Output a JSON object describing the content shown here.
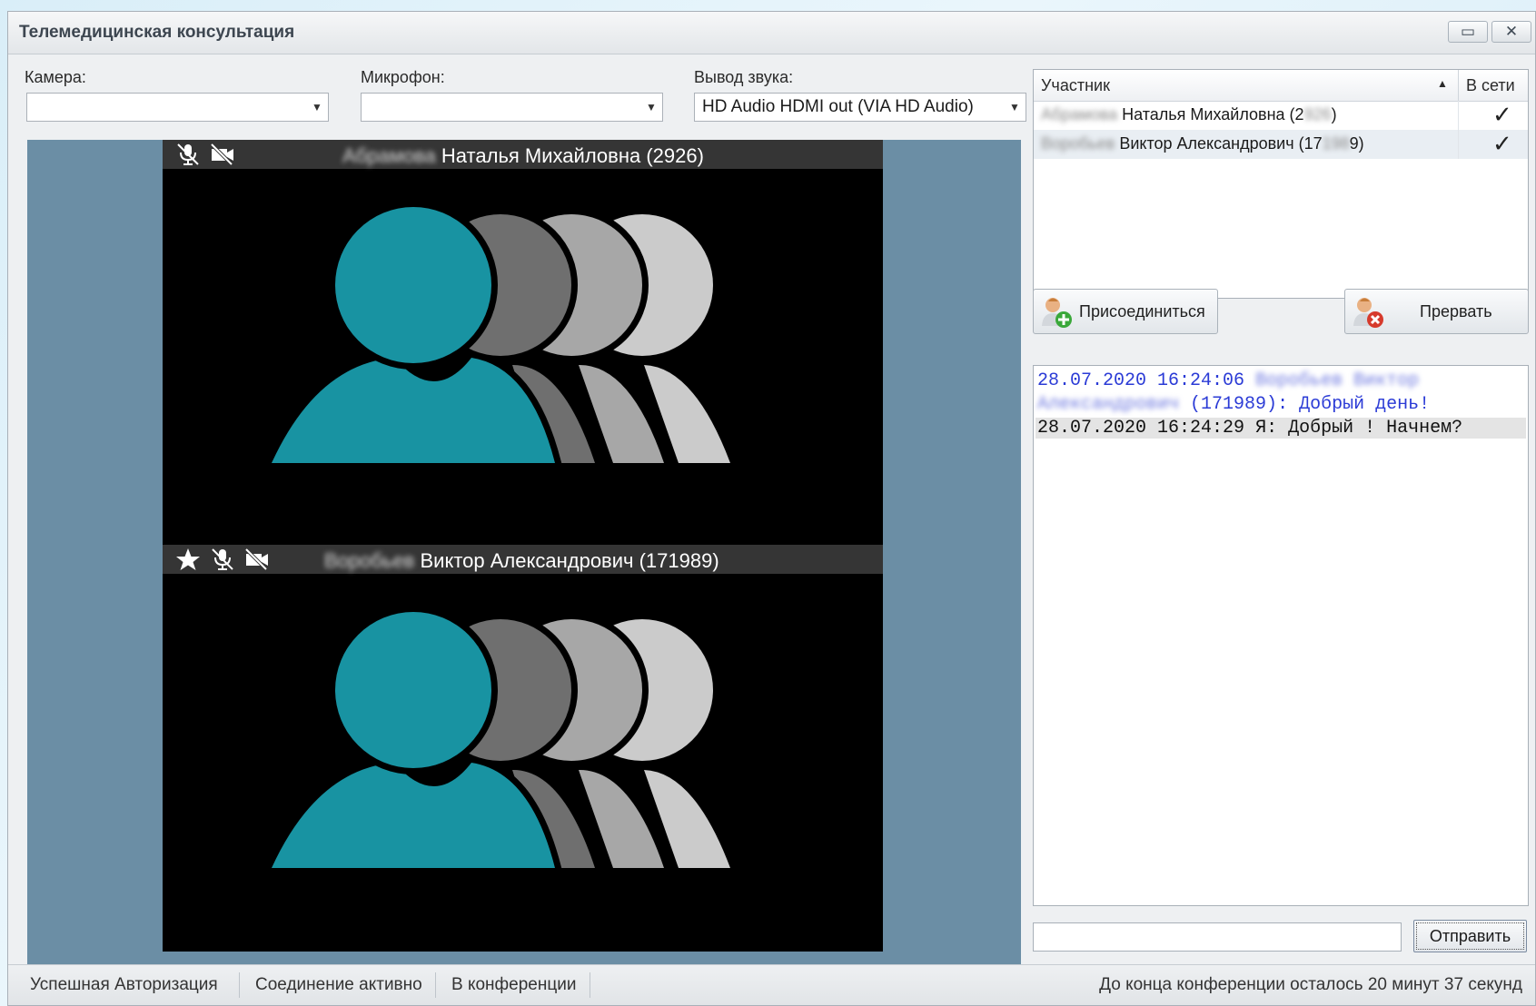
{
  "window": {
    "title": "Телемедицинская консультация",
    "restore_glyph": "▭",
    "close_glyph": "✕"
  },
  "devices": {
    "camera_label": "Камера:",
    "camera_value": "",
    "microphone_label": "Микрофон:",
    "microphone_value": "",
    "audio_out_label": "Вывод звука:",
    "audio_out_value": "HD Audio HDMI out (VIA HD Audio)"
  },
  "video_tiles": [
    {
      "surname_blurred": "Абрамова",
      "name": "Наталья Михайловна (2926)",
      "icons": [
        "mic-muted-icon",
        "camera-off-icon"
      ]
    },
    {
      "surname_blurred": "Воробьев",
      "name": "Виктор Александрович (171989)",
      "icons": [
        "star-icon",
        "mic-muted-icon",
        "camera-off-icon"
      ]
    }
  ],
  "participants": {
    "col_name": "Участник",
    "col_online": "В сети",
    "sort_glyph": "▲",
    "rows": [
      {
        "surname_blurred": "Абрамова",
        "name": "Наталья Михайловна (2",
        "id_blurred": "926",
        "id_end": ")",
        "online_glyph": "✓"
      },
      {
        "surname_blurred": "Воробьев",
        "name": "Виктор Александрович (17",
        "id_blurred": "198",
        "id_end": "9)",
        "online_glyph": "✓"
      }
    ]
  },
  "actions": {
    "join_label": "Присоединиться",
    "leave_label": "Прервать"
  },
  "chat": {
    "messages": [
      {
        "timestamp": "28.07.2020 16:24:06",
        "author_blurred": "Воробьев Виктор",
        "author_blurred_2": "Александрович",
        "text": "(171989): Добрый день!"
      },
      {
        "timestamp": "28.07.2020 16:24:29",
        "text": "Я: Добрый ! Начнем?"
      }
    ],
    "input_value": "",
    "send_label": "Отправить"
  },
  "status": {
    "auth": "Успешная Авторизация",
    "connection": "Соединение активно",
    "conference": "В конференции",
    "remaining": "До конца конференции осталось 20 минут 37 секунд"
  },
  "colors": {
    "avatar_main": "#1893a2",
    "avatar_shade_1": "#6f6f6f",
    "avatar_shade_2": "#a7a7a7",
    "avatar_shade_3": "#cbcbcb",
    "video_backdrop": "#6b8ea5",
    "chat_blue": "#2b3bd6"
  }
}
